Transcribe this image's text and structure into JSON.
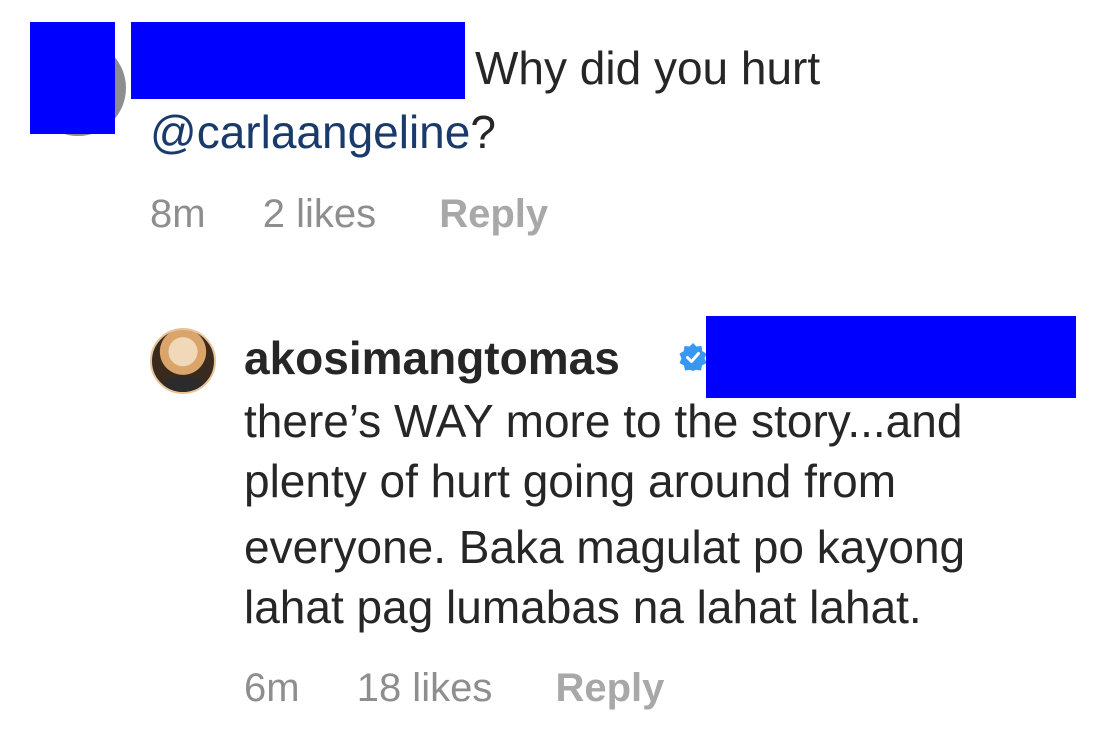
{
  "comment": {
    "text_line1": "Why did you hurt",
    "mention": "@carlaangeline",
    "mention_suffix": "?",
    "time": "8m",
    "likes": "2 likes",
    "reply_label": "Reply"
  },
  "reply": {
    "username": "akosimangtomas",
    "lines": [
      "there’s WAY more to the story...and",
      "plenty of hurt going around from",
      "everyone. Baka magulat po kayong",
      "lahat pag lumabas na lahat lahat."
    ],
    "time": "6m",
    "likes": "18 likes",
    "reply_label": "Reply"
  },
  "colors": {
    "redaction": "#0000ff",
    "mention": "#1a3a6b",
    "meta_text": "#8e8e8e",
    "verified": "#3897f0"
  },
  "icons": {
    "verified": "verified-badge-icon"
  }
}
